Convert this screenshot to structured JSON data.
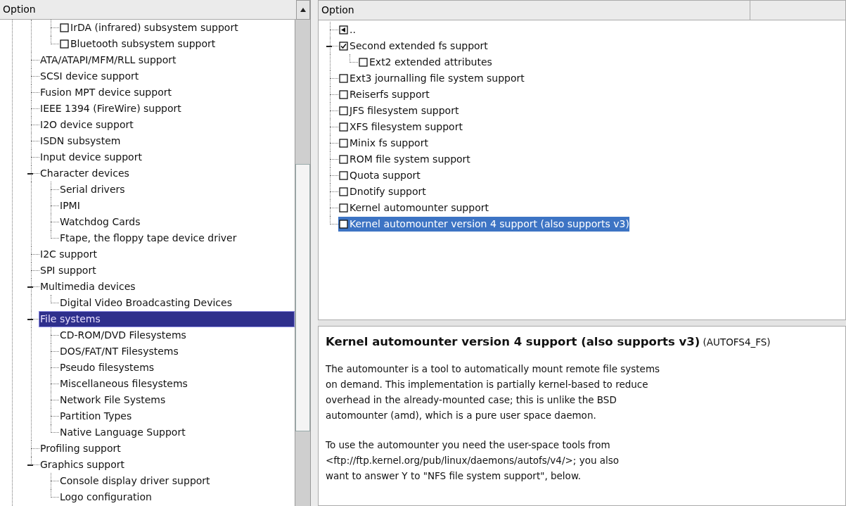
{
  "left_tree": {
    "header": "Option",
    "items": [
      {
        "kind": "continued",
        "children": [
          {
            "label": "IrDA (infrared) subsystem support",
            "kind": "checkbox",
            "checked": false,
            "selected": false
          },
          {
            "label": "Bluetooth subsystem support",
            "kind": "checkbox",
            "checked": false,
            "selected": false
          }
        ]
      },
      {
        "label": "ATA/ATAPI/MFM/RLL support",
        "kind": "menu",
        "selected": false
      },
      {
        "label": "SCSI device support",
        "kind": "menu",
        "selected": false
      },
      {
        "label": "Fusion MPT device support",
        "kind": "menu",
        "selected": false
      },
      {
        "label": "IEEE 1394 (FireWire) support",
        "kind": "menu",
        "selected": false
      },
      {
        "label": "I2O device support",
        "kind": "menu",
        "selected": false
      },
      {
        "label": "ISDN subsystem",
        "kind": "menu",
        "selected": false
      },
      {
        "label": "Input device support",
        "kind": "menu",
        "selected": false
      },
      {
        "label": "Character devices",
        "kind": "menu",
        "expanded": true,
        "selected": false,
        "children": [
          {
            "label": "Serial drivers",
            "kind": "menu",
            "selected": false
          },
          {
            "label": "IPMI",
            "kind": "menu",
            "selected": false
          },
          {
            "label": "Watchdog Cards",
            "kind": "menu",
            "selected": false
          },
          {
            "label": "Ftape, the floppy tape device driver",
            "kind": "menu",
            "selected": false
          }
        ]
      },
      {
        "label": "I2C support",
        "kind": "menu",
        "selected": false
      },
      {
        "label": "SPI support",
        "kind": "menu",
        "selected": false
      },
      {
        "label": "Multimedia devices",
        "kind": "menu",
        "expanded": true,
        "selected": false,
        "children": [
          {
            "label": "Digital Video Broadcasting Devices",
            "kind": "menu",
            "selected": false
          }
        ]
      },
      {
        "label": "File systems",
        "kind": "menu",
        "expanded": true,
        "selected": true,
        "children": [
          {
            "label": "CD-ROM/DVD Filesystems",
            "kind": "menu",
            "selected": false
          },
          {
            "label": "DOS/FAT/NT Filesystems",
            "kind": "menu",
            "selected": false
          },
          {
            "label": "Pseudo filesystems",
            "kind": "menu",
            "selected": false
          },
          {
            "label": "Miscellaneous filesystems",
            "kind": "menu",
            "selected": false
          },
          {
            "label": "Network File Systems",
            "kind": "menu",
            "selected": false
          },
          {
            "label": "Partition Types",
            "kind": "menu",
            "selected": false
          },
          {
            "label": "Native Language Support",
            "kind": "menu",
            "selected": false
          }
        ]
      },
      {
        "label": "Profiling support",
        "kind": "menu",
        "selected": false
      },
      {
        "label": "Graphics support",
        "kind": "menu",
        "expanded": true,
        "selected": false,
        "children": [
          {
            "label": "Console display driver support",
            "kind": "menu",
            "selected": false
          },
          {
            "label": "Logo configuration",
            "kind": "menu",
            "selected": false
          }
        ]
      }
    ]
  },
  "right_tree": {
    "header": "Option",
    "items": [
      {
        "label": "..",
        "kind": "back",
        "selected": false
      },
      {
        "label": "Second extended fs support",
        "kind": "checkbox",
        "checked": true,
        "expanded": true,
        "selected": false,
        "children": [
          {
            "label": "Ext2 extended attributes",
            "kind": "checkbox",
            "checked": false,
            "selected": false
          }
        ]
      },
      {
        "label": "Ext3 journalling file system support",
        "kind": "checkbox",
        "checked": false,
        "selected": false
      },
      {
        "label": "Reiserfs support",
        "kind": "checkbox",
        "checked": false,
        "selected": false
      },
      {
        "label": "JFS filesystem support",
        "kind": "checkbox",
        "checked": false,
        "selected": false
      },
      {
        "label": "XFS filesystem support",
        "kind": "checkbox",
        "checked": false,
        "selected": false
      },
      {
        "label": "Minix fs support",
        "kind": "checkbox",
        "checked": false,
        "selected": false
      },
      {
        "label": "ROM file system support",
        "kind": "checkbox",
        "checked": false,
        "selected": false
      },
      {
        "label": "Quota support",
        "kind": "checkbox",
        "checked": false,
        "selected": false
      },
      {
        "label": "Dnotify support",
        "kind": "checkbox",
        "checked": false,
        "selected": false
      },
      {
        "label": "Kernel automounter support",
        "kind": "checkbox",
        "checked": false,
        "selected": false
      },
      {
        "label": "Kernel automounter version 4 support (also supports v3)",
        "kind": "checkbox",
        "checked": false,
        "selected": true
      }
    ]
  },
  "help": {
    "title": "Kernel automounter version 4 support (also supports v3)",
    "symbol": "(AUTOFS4_FS)",
    "paragraphs": [
      "The automounter is a tool to automatically mount remote file systems\non demand. This implementation is partially kernel-based to reduce\noverhead in the already-mounted case; this is unlike the BSD\nautomounter (amd), which is a pure user space daemon.",
      "To use the automounter you need the user-space tools from\n<ftp://ftp.kernel.org/pub/linux/daemons/autofs/v4/>; you also\nwant to answer Y to \"NFS file system support\", below."
    ]
  }
}
